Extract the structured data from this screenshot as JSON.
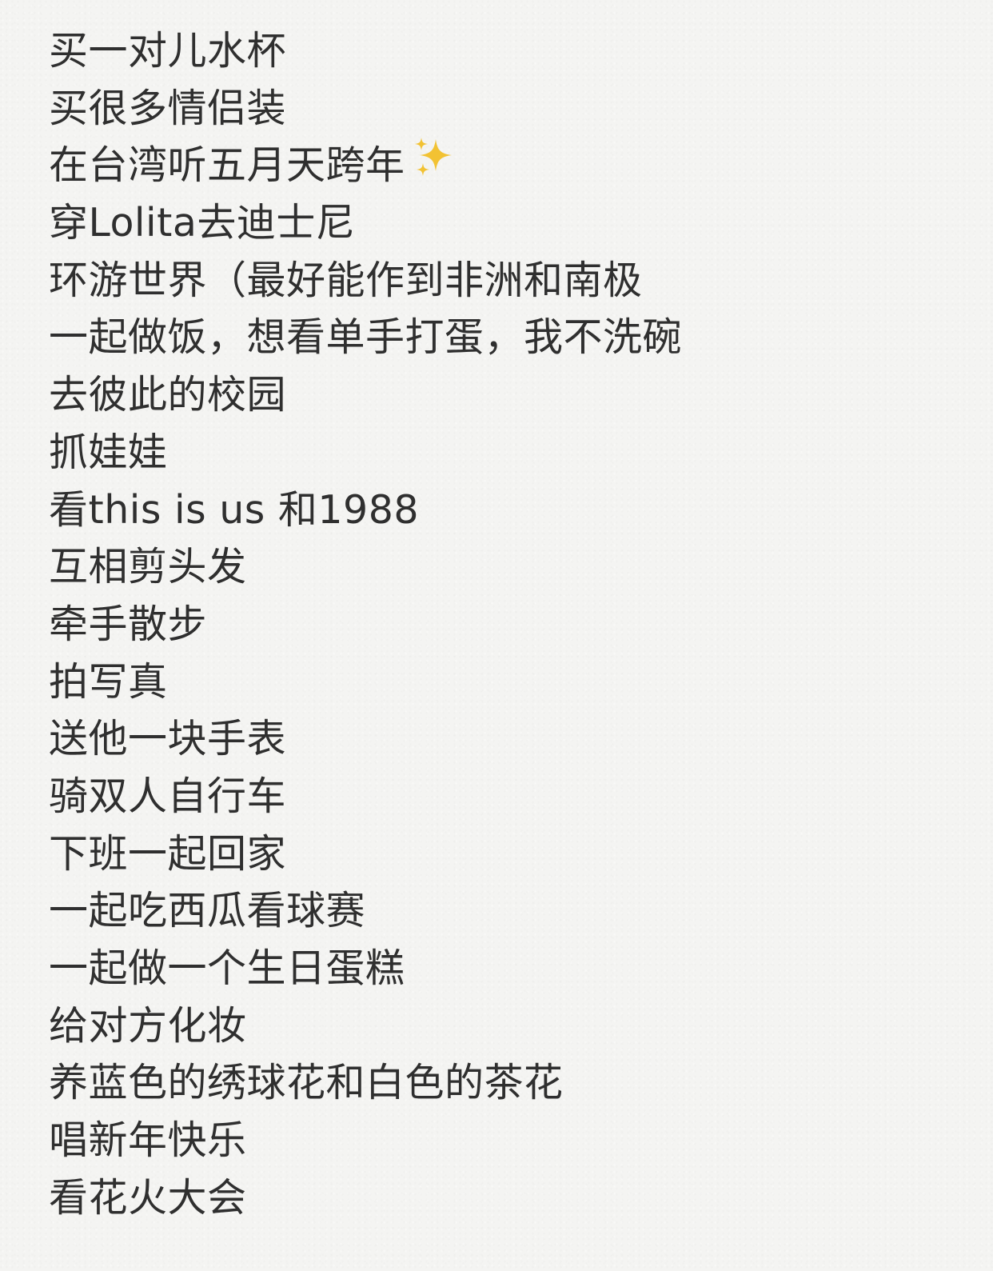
{
  "note": {
    "lines": [
      "买一对儿水杯",
      "买很多情侣装",
      "在台湾听五月天跨年",
      "穿Lolita去迪士尼",
      "环游世界（最好能作到非洲和南极",
      "一起做饭，想看单手打蛋，我不洗碗",
      "去彼此的校园",
      "抓娃娃",
      "看this is us 和1988",
      "互相剪头发",
      "牵手散步",
      "拍写真",
      "送他一块手表",
      "骑双人自行车",
      "下班一起回家",
      "一起吃西瓜看球赛",
      "一起做一个生日蛋糕",
      "给对方化妆",
      "养蓝色的绣球花和白色的茶花",
      "唱新年快乐",
      "看花火大会"
    ],
    "sparkle_icon": "sparkles-icon",
    "colors": {
      "background": "#f4f4f2",
      "text": "#2f2f2f",
      "sparkle_gold": "#f2c233"
    }
  }
}
